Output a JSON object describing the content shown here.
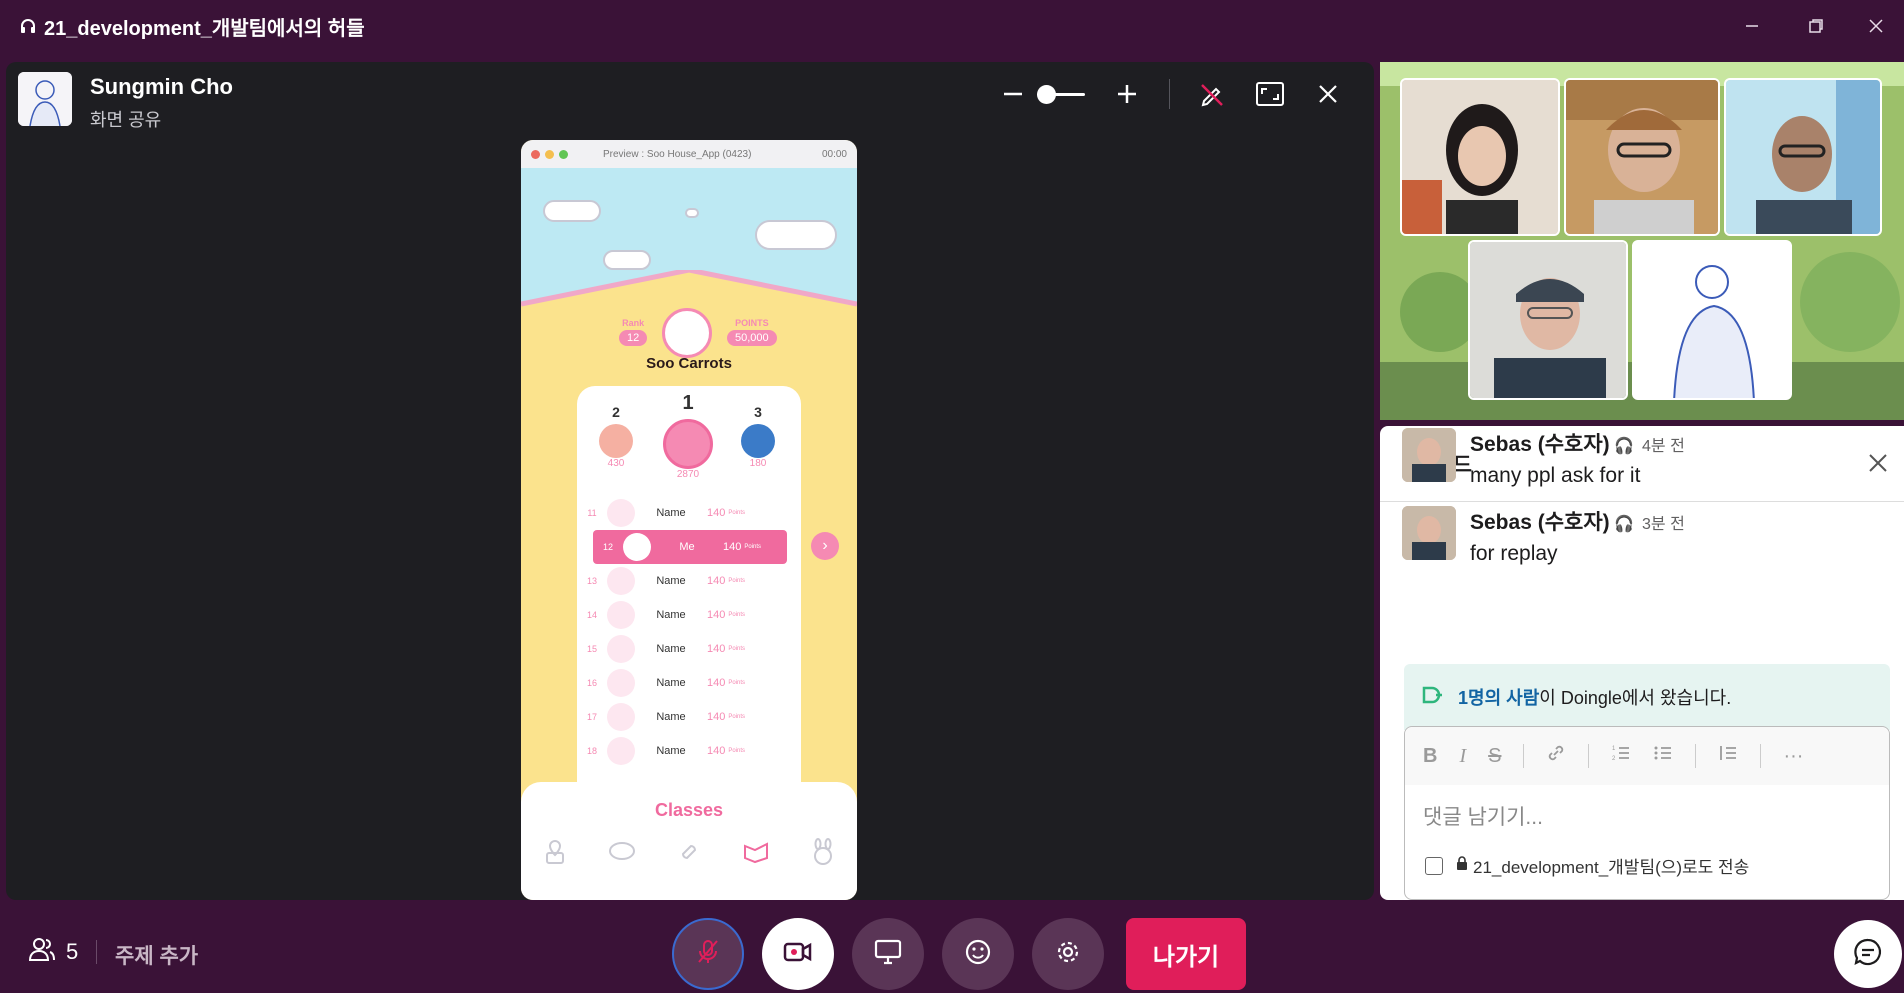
{
  "window": {
    "title": "21_development_개발팀에서의 허들"
  },
  "presenter": {
    "name": "Sungmin Cho",
    "subtitle": "화면 공유"
  },
  "phone": {
    "title": "Preview : Soo House_App (0423)",
    "time": "00:00",
    "rank_label": "Rank",
    "rank": "12",
    "points_label": "POINTS",
    "points": "50,000",
    "user": "Soo Carrots",
    "podium": [
      {
        "place": "2",
        "score": "430"
      },
      {
        "place": "1",
        "score": "2870"
      },
      {
        "place": "3",
        "score": "180"
      }
    ],
    "rows": [
      {
        "rank": "11",
        "name": "Name",
        "points": "140",
        "unit": "Points"
      },
      {
        "rank": "12",
        "name": "Me",
        "points": "140",
        "unit": "Points"
      },
      {
        "rank": "13",
        "name": "Name",
        "points": "140",
        "unit": "Points"
      },
      {
        "rank": "14",
        "name": "Name",
        "points": "140",
        "unit": "Points"
      },
      {
        "rank": "15",
        "name": "Name",
        "points": "140",
        "unit": "Points"
      },
      {
        "rank": "16",
        "name": "Name",
        "points": "140",
        "unit": "Points"
      },
      {
        "rank": "17",
        "name": "Name",
        "points": "140",
        "unit": "Points"
      },
      {
        "rank": "18",
        "name": "Name",
        "points": "140",
        "unit": "Points"
      }
    ],
    "drawer_label": "Classes"
  },
  "thread": {
    "title": "스레드",
    "messages": [
      {
        "author": "Sebas (수호자)",
        "time": "4분 전",
        "text": "many ppl ask for it"
      },
      {
        "author": "Sebas (수호자)",
        "time": "3분 전",
        "text": "for replay"
      }
    ],
    "joined_link": "1명의 사람",
    "joined_rest": "이 Doingle에서 왔습니다.",
    "placeholder": "댓글 남기기...",
    "also_send": "21_development_개발팀(으)로도 전송"
  },
  "bottom": {
    "participants": "5",
    "topic": "주제 추가",
    "leave": "나가기"
  },
  "colors": {
    "aubergine": "#3a1237",
    "leave": "#e01e5a",
    "app_pink": "#f06a9e",
    "app_yellow": "#fbe38d"
  }
}
